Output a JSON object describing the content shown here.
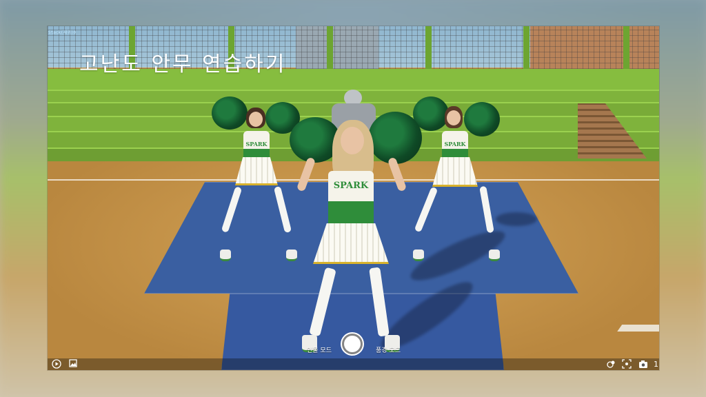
{
  "overlay": {
    "title": "고난도 안무 연습하기",
    "debug_lines": [
      "Stack(재귀)0"
    ],
    "debug_lines_green": []
  },
  "camera": {
    "mode_left": "인물 모드",
    "mode_right": "풍경 모드",
    "right_counter": "1"
  },
  "cheerleader": {
    "uniform_text": "SPARK"
  },
  "icons": {
    "play": "play-icon",
    "gallery": "gallery-icon",
    "shutter": "shutter-icon",
    "effects": "effects-icon",
    "fullscreen": "fullscreen-icon",
    "camera": "camera-icon"
  },
  "colors": {
    "turf_green": "#7fb33c",
    "uniform_green": "#2f8d3a",
    "mat_blue": "#3a5fa1",
    "dirt": "#c99a4c"
  }
}
